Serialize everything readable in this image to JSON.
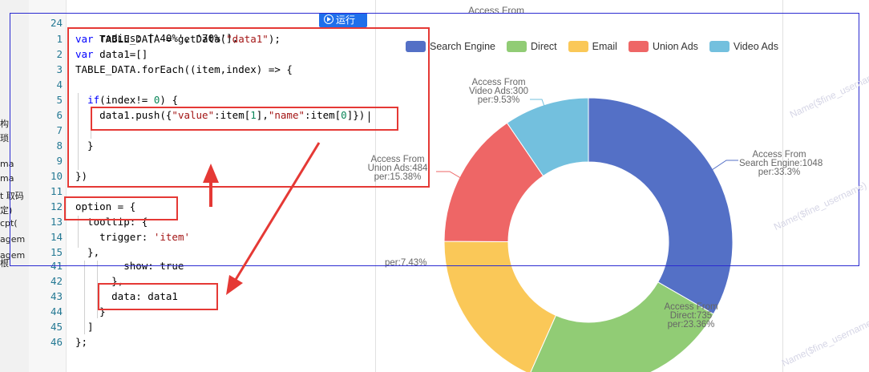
{
  "toolbar": {
    "run_label": "运行"
  },
  "left_strip": [
    "构",
    "琐",
    "",
    "ma",
    "ma",
    "t 取码",
    "定)",
    "cpt(",
    "agem",
    "agem",
    "根"
  ],
  "code_top": {
    "num": "24",
    "text": "    radius: ['40%', '70%'],",
    "partial": "Access From"
  },
  "code": [
    {
      "n": "1",
      "t": "var TABLE_DATA = getData(\"data1\");"
    },
    {
      "n": "2",
      "t": "var data1=[]"
    },
    {
      "n": "3",
      "t": "TABLE_DATA.forEach((item,index) => {"
    },
    {
      "n": "4",
      "t": ""
    },
    {
      "n": "5",
      "t": "  if(index!= 0) {"
    },
    {
      "n": "6",
      "t": "    data1.push({\"value\":item[1],\"name\":item[0]})"
    },
    {
      "n": "7",
      "t": ""
    },
    {
      "n": "8",
      "t": "  }"
    },
    {
      "n": "9",
      "t": ""
    },
    {
      "n": "10",
      "t": "})"
    },
    {
      "n": "11",
      "t": ""
    },
    {
      "n": "12",
      "t": "option = {"
    },
    {
      "n": "13",
      "t": "  tooltip: {"
    },
    {
      "n": "14",
      "t": "    trigger: 'item'"
    },
    {
      "n": "15",
      "t": "  },"
    }
  ],
  "code_bottom": [
    {
      "n": "41",
      "t": "        show: true"
    },
    {
      "n": "42",
      "t": "      },"
    },
    {
      "n": "43",
      "t": "      data: data1"
    },
    {
      "n": "44",
      "t": "    }"
    },
    {
      "n": "45",
      "t": "  ]"
    },
    {
      "n": "46",
      "t": "};"
    }
  ],
  "chart_data": {
    "type": "pie",
    "subtype": "donut",
    "radius": [
      "40%",
      "70%"
    ],
    "title": "",
    "legend_position": "top",
    "legend": [
      "Search Engine",
      "Direct",
      "Email",
      "Union Ads",
      "Video Ads"
    ],
    "series": [
      {
        "name": "Search Engine",
        "value": 1048,
        "pct": 33.3,
        "color": "#5470c6",
        "label": [
          "Access From",
          "Search Engine:1048",
          "per:33.3%"
        ]
      },
      {
        "name": "Direct",
        "value": 735,
        "pct": 23.36,
        "color": "#91cc75",
        "label": [
          "Access From",
          "Direct:735",
          "per:23.36%"
        ]
      },
      {
        "name": "Email",
        "value": 580,
        "pct": 18.43,
        "color": "#fac858",
        "label": [
          "",
          "",
          ""
        ]
      },
      {
        "name": "Union Ads",
        "value": 484,
        "pct": 15.38,
        "color": "#ee6666",
        "label": [
          "Access From",
          "Union Ads:484",
          "per:15.38%"
        ]
      },
      {
        "name": "Video Ads",
        "value": 300,
        "pct": 9.53,
        "color": "#73c0de",
        "label": [
          "Access From",
          "Video Ads:300",
          "per:9.53%"
        ]
      }
    ]
  },
  "partial_labels": {
    "behind": "per:7.43%"
  },
  "watermark": "Name($fine_username)"
}
